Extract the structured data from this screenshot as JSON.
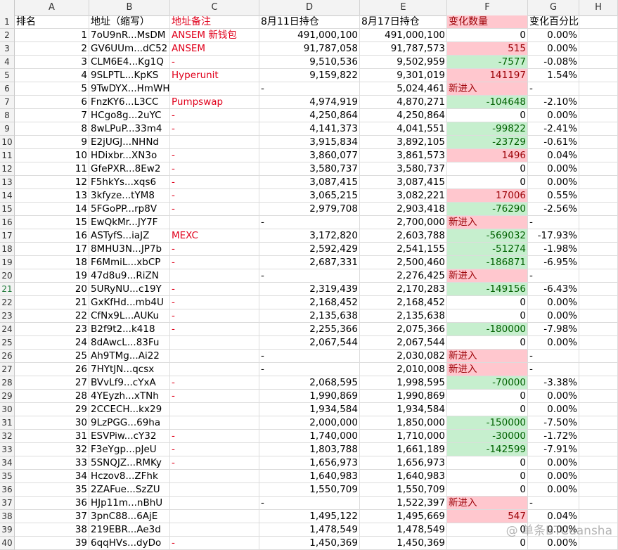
{
  "columns": [
    "A",
    "B",
    "C",
    "D",
    "E",
    "F",
    "G",
    "H"
  ],
  "header": {
    "rank": "排名",
    "addr": "地址（缩写）",
    "note": "地址备注",
    "aug11": "8月11日持仓",
    "aug17": "8月17日持仓",
    "change": "变化数量",
    "pct": "变化百分比"
  },
  "rows": [
    {
      "n": "2",
      "rank": "1",
      "addr": "7oU9nR...MsDM",
      "note": "ANSEM 新钱包",
      "aug11": "491,000,100",
      "aug17": "491,000,100",
      "change": "0",
      "pct": "0.00%",
      "t": "zero"
    },
    {
      "n": "3",
      "rank": "2",
      "addr": "GV6UUm...dC52",
      "note": "ANSEM",
      "aug11": "91,787,058",
      "aug17": "91,787,573",
      "change": "515",
      "pct": "0.00%",
      "t": "pos"
    },
    {
      "n": "4",
      "rank": "3",
      "addr": "CLM6E4...Kg1Q",
      "note": "-",
      "aug11": "9,510,536",
      "aug17": "9,502,959",
      "change": "-7577",
      "pct": "-0.08%",
      "t": "neg"
    },
    {
      "n": "5",
      "rank": "4",
      "addr": "9SLPTL...KpKS",
      "note": "Hyperunit",
      "aug11": "9,159,822",
      "aug17": "9,301,019",
      "change": "141197",
      "pct": "1.54%",
      "t": "pos"
    },
    {
      "n": "6",
      "rank": "5",
      "addr": "9TwDYX...HmWH",
      "note": "",
      "aug11": "-",
      "aug17": "5,024,461",
      "change": "新进入",
      "pct": "-",
      "t": "new"
    },
    {
      "n": "7",
      "rank": "6",
      "addr": "FnzKY6...L3CC",
      "note": "Pumpswap",
      "aug11": "4,974,919",
      "aug17": "4,870,271",
      "change": "-104648",
      "pct": "-2.10%",
      "t": "neg"
    },
    {
      "n": "8",
      "rank": "7",
      "addr": "HCgo8g...2uYC",
      "note": "-",
      "aug11": "4,250,864",
      "aug17": "4,250,864",
      "change": "0",
      "pct": "0.00%",
      "t": "zero"
    },
    {
      "n": "9",
      "rank": "8",
      "addr": "8wLPuP...33m4",
      "note": "-",
      "aug11": "4,141,373",
      "aug17": "4,041,551",
      "change": "-99822",
      "pct": "-2.41%",
      "t": "neg"
    },
    {
      "n": "10",
      "rank": "9",
      "addr": "E2jUGJ...NHNd",
      "note": "",
      "aug11": "3,915,834",
      "aug17": "3,892,105",
      "change": "-23729",
      "pct": "-0.61%",
      "t": "neg"
    },
    {
      "n": "11",
      "rank": "10",
      "addr": "HDixbr...XN3o",
      "note": "-",
      "aug11": "3,860,077",
      "aug17": "3,861,573",
      "change": "1496",
      "pct": "0.04%",
      "t": "pos"
    },
    {
      "n": "12",
      "rank": "11",
      "addr": "GfePXR...8Ew2",
      "note": "-",
      "aug11": "3,580,737",
      "aug17": "3,580,737",
      "change": "0",
      "pct": "0.00%",
      "t": "zero"
    },
    {
      "n": "13",
      "rank": "12",
      "addr": "F5hkYs...xqs6",
      "note": "-",
      "aug11": "3,087,415",
      "aug17": "3,087,415",
      "change": "0",
      "pct": "0.00%",
      "t": "zero"
    },
    {
      "n": "14",
      "rank": "13",
      "addr": "3kfyze...tYM8",
      "note": "-",
      "aug11": "3,065,215",
      "aug17": "3,082,221",
      "change": "17006",
      "pct": "0.55%",
      "t": "pos"
    },
    {
      "n": "15",
      "rank": "14",
      "addr": "5FGoPP...rp8V",
      "note": "-",
      "aug11": "2,979,708",
      "aug17": "2,903,418",
      "change": "-76290",
      "pct": "-2.56%",
      "t": "neg"
    },
    {
      "n": "16",
      "rank": "15",
      "addr": "EwQkMr...JY7F",
      "note": "",
      "aug11": "-",
      "aug17": "2,700,000",
      "change": "新进入",
      "pct": "-",
      "t": "new"
    },
    {
      "n": "17",
      "rank": "16",
      "addr": "ASTyfS...iaJZ",
      "note": "MEXC",
      "aug11": "3,172,820",
      "aug17": "2,603,788",
      "change": "-569032",
      "pct": "-17.93%",
      "t": "neg"
    },
    {
      "n": "18",
      "rank": "17",
      "addr": "8MHU3N...JP7b",
      "note": "-",
      "aug11": "2,592,429",
      "aug17": "2,541,155",
      "change": "-51274",
      "pct": "-1.98%",
      "t": "neg"
    },
    {
      "n": "19",
      "rank": "18",
      "addr": "F6MmiL...xbCP",
      "note": "-",
      "aug11": "2,687,331",
      "aug17": "2,500,460",
      "change": "-186871",
      "pct": "-6.95%",
      "t": "neg"
    },
    {
      "n": "20",
      "rank": "19",
      "addr": "47d8u9...RiZN",
      "note": "",
      "aug11": "-",
      "aug17": "2,276,425",
      "change": "新进入",
      "pct": "-",
      "t": "new"
    },
    {
      "n": "21",
      "rank": "20",
      "addr": "5URyNU...c19Y",
      "note": "-",
      "aug11": "2,319,439",
      "aug17": "2,170,283",
      "change": "-149156",
      "pct": "-6.43%",
      "t": "neg",
      "sel": true
    },
    {
      "n": "22",
      "rank": "21",
      "addr": "GxKfHd...mb4U",
      "note": "-",
      "aug11": "2,168,452",
      "aug17": "2,168,452",
      "change": "0",
      "pct": "0.00%",
      "t": "zero"
    },
    {
      "n": "23",
      "rank": "22",
      "addr": "CfNx9L...AUKu",
      "note": "-",
      "aug11": "2,135,638",
      "aug17": "2,135,638",
      "change": "0",
      "pct": "0.00%",
      "t": "zero"
    },
    {
      "n": "24",
      "rank": "23",
      "addr": "B2f9t2...k418",
      "note": "-",
      "aug11": "2,255,366",
      "aug17": "2,075,366",
      "change": "-180000",
      "pct": "-7.98%",
      "t": "neg"
    },
    {
      "n": "25",
      "rank": "24",
      "addr": "8dAwcL...83Fu",
      "note": "",
      "aug11": "2,067,544",
      "aug17": "2,067,544",
      "change": "0",
      "pct": "0.00%",
      "t": "zero"
    },
    {
      "n": "26",
      "rank": "25",
      "addr": "Ah9TMg...Ai22",
      "note": "",
      "aug11": "-",
      "aug17": "2,030,082",
      "change": "新进入",
      "pct": "-",
      "t": "new"
    },
    {
      "n": "27",
      "rank": "26",
      "addr": "7HYtJN...qcsx",
      "note": "",
      "aug11": "-",
      "aug17": "2,010,008",
      "change": "新进入",
      "pct": "-",
      "t": "new"
    },
    {
      "n": "28",
      "rank": "27",
      "addr": "BVvLf9...cYxA",
      "note": "-",
      "aug11": "2,068,595",
      "aug17": "1,998,595",
      "change": "-70000",
      "pct": "-3.38%",
      "t": "neg"
    },
    {
      "n": "29",
      "rank": "28",
      "addr": "4YEyzh...xTNh",
      "note": "-",
      "aug11": "1,990,869",
      "aug17": "1,990,869",
      "change": "0",
      "pct": "0.00%",
      "t": "zero"
    },
    {
      "n": "30",
      "rank": "29",
      "addr": "2CCECH...kx29",
      "note": "",
      "aug11": "1,934,584",
      "aug17": "1,934,584",
      "change": "0",
      "pct": "0.00%",
      "t": "zero"
    },
    {
      "n": "31",
      "rank": "30",
      "addr": "9LzPGG...69ha",
      "note": "",
      "aug11": "2,000,000",
      "aug17": "1,850,000",
      "change": "-150000",
      "pct": "-7.50%",
      "t": "neg"
    },
    {
      "n": "32",
      "rank": "31",
      "addr": "ESVPiw...cY32",
      "note": "-",
      "aug11": "1,740,000",
      "aug17": "1,710,000",
      "change": "-30000",
      "pct": "-1.72%",
      "t": "neg"
    },
    {
      "n": "33",
      "rank": "32",
      "addr": "F3eYgp...pJeU",
      "note": "-",
      "aug11": "1,803,788",
      "aug17": "1,661,189",
      "change": "-142599",
      "pct": "-7.91%",
      "t": "neg"
    },
    {
      "n": "34",
      "rank": "33",
      "addr": "5SNQJZ...RMKy",
      "note": "-",
      "aug11": "1,656,973",
      "aug17": "1,656,973",
      "change": "0",
      "pct": "0.00%",
      "t": "zero"
    },
    {
      "n": "35",
      "rank": "34",
      "addr": "Hczov8...ZFhk",
      "note": "",
      "aug11": "1,640,983",
      "aug17": "1,640,983",
      "change": "0",
      "pct": "0.00%",
      "t": "zero"
    },
    {
      "n": "36",
      "rank": "35",
      "addr": "2ZAFue...SzZU",
      "note": "",
      "aug11": "1,550,709",
      "aug17": "1,550,709",
      "change": "0",
      "pct": "0.00%",
      "t": "zero"
    },
    {
      "n": "37",
      "rank": "36",
      "addr": "HJp11m...nBhU",
      "note": "",
      "aug11": "-",
      "aug17": "1,522,397",
      "change": "新进入",
      "pct": "-",
      "t": "new"
    },
    {
      "n": "38",
      "rank": "37",
      "addr": "3pnC88...6AjE",
      "note": "",
      "aug11": "1,495,122",
      "aug17": "1,495,669",
      "change": "547",
      "pct": "0.04%",
      "t": "pos"
    },
    {
      "n": "39",
      "rank": "38",
      "addr": "219EBR...Ae3d",
      "note": "",
      "aug11": "1,478,549",
      "aug17": "1,478,549",
      "change": "0",
      "pct": "0.00%",
      "t": "zero"
    },
    {
      "n": "40",
      "rank": "39",
      "addr": "6qqHVs...dyDo",
      "note": "-",
      "aug11": "1,450,369",
      "aug17": "1,450,369",
      "change": "0",
      "pct": "0.00%",
      "t": "zero"
    }
  ],
  "watermark": "@ 单条BTCdansha",
  "colors": {
    "pos_bg": "#ffc7ce",
    "pos_fg": "#9c0006",
    "neg_bg": "#c6efce",
    "neg_fg": "#006100",
    "note_red": "#e0001b"
  }
}
